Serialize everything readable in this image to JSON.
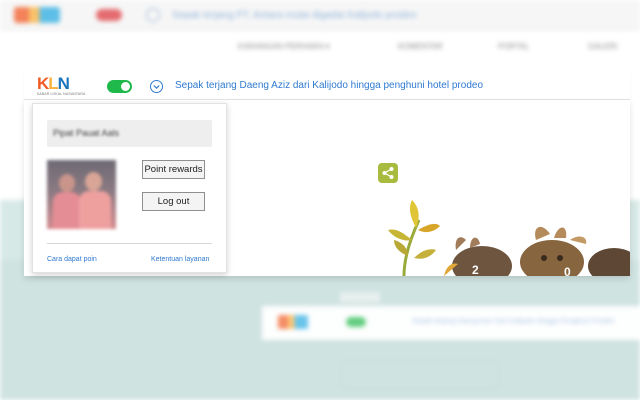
{
  "extension_bar": {
    "logo": {
      "text_k": "K",
      "text_l": "L",
      "text_n": "N",
      "tagline": "KABAR LOKAL NUSANTARA"
    },
    "toggle": {
      "state": "on",
      "color": "#1fb84a"
    },
    "headline": "Sepak terjang Daeng Aziz dari Kalijodo hingga penghuni hotel prodeo"
  },
  "popup": {
    "user_name": "Pipat Pauat Aals",
    "points_button_label": "Point rewards",
    "logout_button_label": "Log out",
    "link_earn_points": "Cara dapat poin",
    "link_terms": "Ketentuan layanan"
  },
  "background": {
    "blurred_headline": "Sepak terjang PT. Antara mulai digadai Kalijodo prodeo",
    "nav_items": [
      "KARANGAN PERHARA ▾",
      "KOMENTAR",
      "PORTAL",
      "GALERI"
    ],
    "card_text": "Sepak terjang Daeng Aziz Dari Kalijodo Hingga Penghuni Prodeo"
  },
  "colors": {
    "accent": "#2f7ad1",
    "share_button": "#a9bb3f",
    "logo_orange": "#f15a24",
    "logo_yellow": "#fbb03b",
    "logo_blue": "#1b75bb"
  },
  "icons": {
    "toggle": "toggle-switch-icon",
    "expand": "chevron-down-circle-icon",
    "share": "share-icon"
  }
}
